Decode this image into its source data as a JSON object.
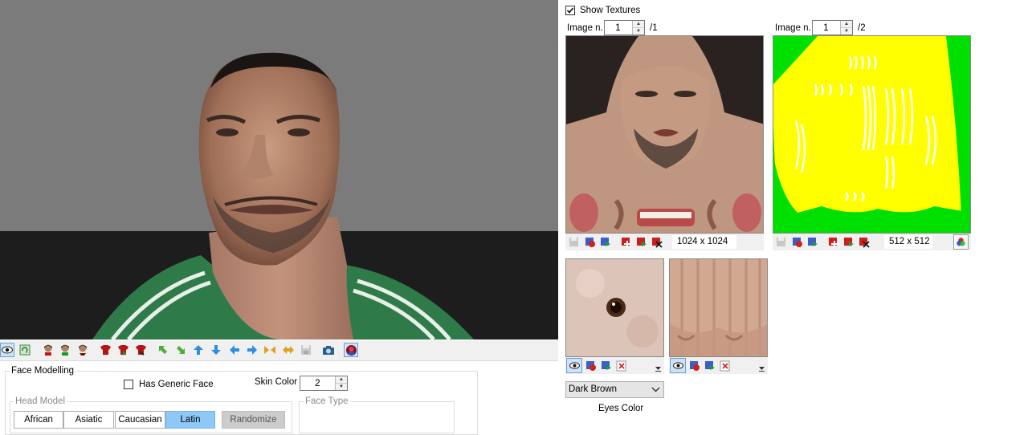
{
  "toolbar": {
    "icons": [
      "eye-icon",
      "refresh-icon",
      "head-red-icon",
      "head-green-icon",
      "head-black-icon",
      "shirt-red-icon",
      "shirt-green-icon",
      "shirt-black-icon",
      "arrow-upleft-icon",
      "arrow-downright-icon",
      "arrow-up-icon",
      "arrow-down-icon",
      "arrow-left-icon",
      "arrow-right-icon",
      "shrink-horizontal-icon",
      "expand-horizontal-icon",
      "save-icon",
      "camera-icon",
      "jersey-icon"
    ]
  },
  "textures": {
    "show_textures_label": "Show Textures",
    "show_textures_checked": true,
    "panel1": {
      "image_label": "Image n.",
      "image_value": "1",
      "image_total": "/1",
      "size": "1024 x 1024"
    },
    "panel2": {
      "image_label": "Image n.",
      "image_value": "1",
      "image_total": "/2",
      "size": "512 x 512"
    },
    "eyes": {
      "color_value": "Dark Brown",
      "color_label": "Eyes Color"
    }
  },
  "face": {
    "section_title": "Face Modelling",
    "generic_face_label": "Has Generic Face",
    "generic_face_checked": false,
    "skin_color_label": "Skin Color",
    "skin_color_value": "2",
    "head_model_label": "Head Model",
    "head_models": [
      "African",
      "Asiatic",
      "Caucasian",
      "Latin"
    ],
    "selected_head_model": "Latin",
    "randomize_label": "Randomize",
    "face_type_label": "Face Type"
  },
  "colors": {
    "accent_selected": "#8ec8f6",
    "chroma_yellow": "#ffff00",
    "chroma_green": "#00ff00"
  }
}
